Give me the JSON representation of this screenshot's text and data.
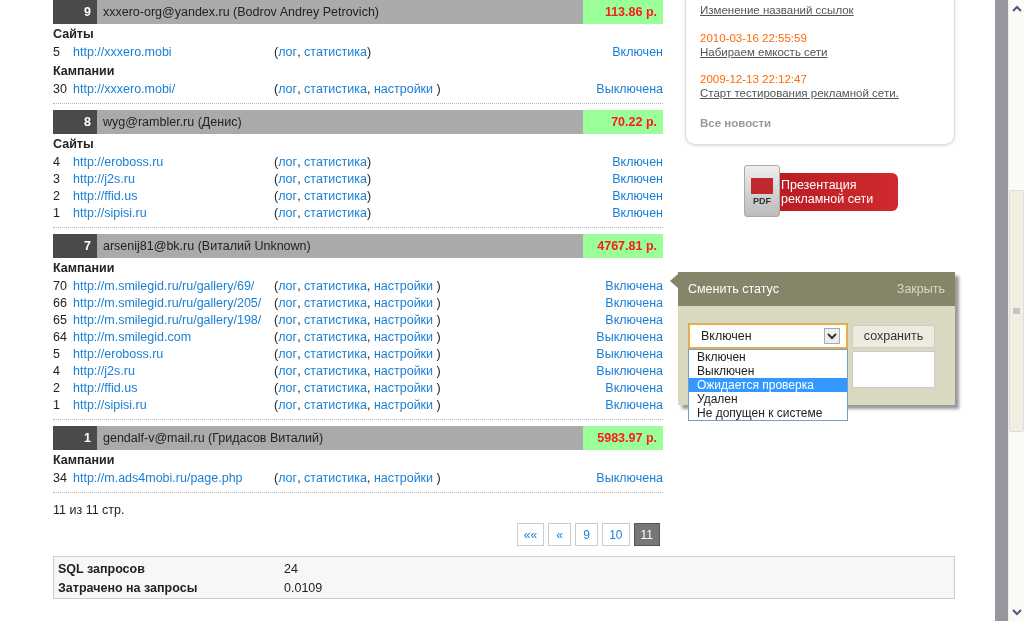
{
  "punctuation": {
    "open": "(",
    "separator": ", "
  },
  "users": [
    {
      "number": "9",
      "account": "xxxero-org@yandex.ru (Bodrov Andrey Petrovich)",
      "amount": "113.86 р.",
      "groups": [
        {
          "title": "Сайты",
          "close": ")",
          "rows": [
            {
              "id": "5",
              "url": "http://xxxero.mobi",
              "links": [
                "лог",
                "статистика"
              ],
              "status": "Включен"
            }
          ]
        },
        {
          "title": "Кампании",
          "close": " )",
          "rows": [
            {
              "id": "30",
              "url": "http://xxxero.mobi/",
              "links": [
                "лог",
                "статистика",
                "настройки"
              ],
              "status": "Выключена"
            }
          ]
        }
      ]
    },
    {
      "number": "8",
      "account": "wyg@rambler.ru (Денис)",
      "amount": "70.22 р.",
      "groups": [
        {
          "title": "Сайты",
          "close": ")",
          "rows": [
            {
              "id": "4",
              "url": "http://eroboss.ru",
              "links": [
                "лог",
                "статистика"
              ],
              "status": "Включен"
            },
            {
              "id": "3",
              "url": "http://j2s.ru",
              "links": [
                "лог",
                "статистика"
              ],
              "status": "Включен"
            },
            {
              "id": "2",
              "url": "http://ffid.us",
              "links": [
                "лог",
                "статистика"
              ],
              "status": "Включен"
            },
            {
              "id": "1",
              "url": "http://sipisi.ru",
              "links": [
                "лог",
                "статистика"
              ],
              "status": "Включен"
            }
          ]
        }
      ]
    },
    {
      "number": "7",
      "account": "arsenij81@bk.ru (Виталий Unknown)",
      "amount": "4767.81 р.",
      "groups": [
        {
          "title": "Кампании",
          "close": " )",
          "rows": [
            {
              "id": "70",
              "url": "http://m.smilegid.ru/ru/gallery/69/",
              "links": [
                "лог",
                "статистика",
                "настройки"
              ],
              "status": "Включена"
            },
            {
              "id": "66",
              "url": "http://m.smilegid.ru/ru/gallery/205/",
              "links": [
                "лог",
                "статистика",
                "настройки"
              ],
              "status": "Включена"
            },
            {
              "id": "65",
              "url": "http://m.smilegid.ru/ru/gallery/198/",
              "links": [
                "лог",
                "статистика",
                "настройки"
              ],
              "status": "Включена"
            },
            {
              "id": "64",
              "url": "http://m.smilegid.com",
              "links": [
                "лог",
                "статистика",
                "настройки"
              ],
              "status": "Выключена"
            },
            {
              "id": "5",
              "url": "http://eroboss.ru",
              "links": [
                "лог",
                "статистика",
                "настройки"
              ],
              "status": "Выключена"
            },
            {
              "id": "4",
              "url": "http://j2s.ru",
              "links": [
                "лог",
                "статистика",
                "настройки"
              ],
              "status": "Выключена"
            },
            {
              "id": "2",
              "url": "http://ffid.us",
              "links": [
                "лог",
                "статистика",
                "настройки"
              ],
              "status": "Включена"
            },
            {
              "id": "1",
              "url": "http://sipisi.ru",
              "links": [
                "лог",
                "статистика",
                "настройки"
              ],
              "status": "Включена"
            }
          ]
        }
      ]
    },
    {
      "number": "1",
      "account": "gendalf-v@mail.ru (Гридасов Виталий)",
      "amount": "5983.97 р.",
      "groups": [
        {
          "title": "Кампании",
          "close": " )",
          "rows": [
            {
              "id": "34",
              "url": "http://m.ads4mobi.ru/page.php",
              "links": [
                "лог",
                "статистика",
                "настройки"
              ],
              "status": "Выключена"
            }
          ]
        }
      ]
    }
  ],
  "page_info": "11 из 11 стр.",
  "pagination": [
    {
      "label": "««",
      "selected": false
    },
    {
      "label": "«",
      "selected": false
    },
    {
      "label": "9",
      "selected": false
    },
    {
      "label": "10",
      "selected": false
    },
    {
      "label": "11",
      "selected": true
    }
  ],
  "stats": [
    {
      "label": "SQL запросов",
      "value": "24"
    },
    {
      "label": "Затрачено на запросы",
      "value": "0.0109"
    }
  ],
  "news": {
    "cut_title": "Изменение названий ссылок",
    "items": [
      {
        "date": "2010-03-16 22:55:59",
        "title": "Набираем емкость сети"
      },
      {
        "date": "2009-12-13 22:12:47",
        "title": "Старт тестирования рекламной сети."
      }
    ],
    "all_link": "Все новости"
  },
  "pdf_button": {
    "badge": "PDF",
    "label": "Презентация рекламной сети"
  },
  "status_popup": {
    "title": "Сменить статус",
    "close": "Закрыть",
    "value": "Включен",
    "save": "сохранить",
    "options": [
      {
        "label": "Включен",
        "highlighted": false
      },
      {
        "label": "Выключен",
        "highlighted": false
      },
      {
        "label": "Ожидается проверка",
        "highlighted": true
      },
      {
        "label": "Удален",
        "highlighted": false
      },
      {
        "label": "Не допущен к системе",
        "highlighted": false
      }
    ]
  }
}
